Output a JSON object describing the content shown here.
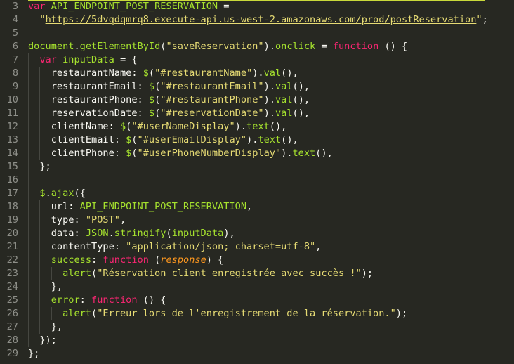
{
  "editor": {
    "lines": [
      {
        "n": "3",
        "tokens": [
          [
            "kw",
            "var "
          ],
          [
            "fn",
            "API_ENDPOINT_POST_RESERVATION"
          ],
          [
            "punct",
            " ="
          ]
        ]
      },
      {
        "n": "4",
        "tokens": [
          [
            "punct",
            "  "
          ],
          [
            "str",
            "\""
          ],
          [
            "url",
            "https://5dvqdqmrq8.execute-api.us-west-2.amazonaws.com/prod/postReservation"
          ],
          [
            "str",
            "\""
          ],
          [
            "punct",
            ";"
          ]
        ]
      },
      {
        "n": "5",
        "tokens": []
      },
      {
        "n": "6",
        "tokens": [
          [
            "fn",
            "document"
          ],
          [
            "punct",
            "."
          ],
          [
            "def",
            "getElementById"
          ],
          [
            "punct",
            "("
          ],
          [
            "str",
            "\"saveReservation\""
          ],
          [
            "punct",
            ")."
          ],
          [
            "def",
            "onclick"
          ],
          [
            "punct",
            " = "
          ],
          [
            "kw",
            "function"
          ],
          [
            "punct",
            " () {"
          ]
        ]
      },
      {
        "n": "7",
        "tokens": [
          [
            "punct",
            "  "
          ],
          [
            "kw",
            "var "
          ],
          [
            "fn",
            "inputData"
          ],
          [
            "punct",
            " = {"
          ]
        ]
      },
      {
        "n": "8",
        "tokens": [
          [
            "punct",
            "    restaurantName: "
          ],
          [
            "def",
            "$"
          ],
          [
            "punct",
            "("
          ],
          [
            "str",
            "\"#restaurantName\""
          ],
          [
            "punct",
            ")."
          ],
          [
            "def",
            "val"
          ],
          [
            "punct",
            "(),"
          ]
        ]
      },
      {
        "n": "9",
        "tokens": [
          [
            "punct",
            "    restaurantEmail: "
          ],
          [
            "def",
            "$"
          ],
          [
            "punct",
            "("
          ],
          [
            "str",
            "\"#restaurantEmail\""
          ],
          [
            "punct",
            ")."
          ],
          [
            "def",
            "val"
          ],
          [
            "punct",
            "(),"
          ]
        ]
      },
      {
        "n": "10",
        "tokens": [
          [
            "punct",
            "    restaurantPhone: "
          ],
          [
            "def",
            "$"
          ],
          [
            "punct",
            "("
          ],
          [
            "str",
            "\"#restaurantPhone\""
          ],
          [
            "punct",
            ")."
          ],
          [
            "def",
            "val"
          ],
          [
            "punct",
            "(),"
          ]
        ]
      },
      {
        "n": "11",
        "tokens": [
          [
            "punct",
            "    reservationDate: "
          ],
          [
            "def",
            "$"
          ],
          [
            "punct",
            "("
          ],
          [
            "str",
            "\"#reservationDate\""
          ],
          [
            "punct",
            ")."
          ],
          [
            "def",
            "val"
          ],
          [
            "punct",
            "(),"
          ]
        ]
      },
      {
        "n": "12",
        "tokens": [
          [
            "punct",
            "    clientName: "
          ],
          [
            "def",
            "$"
          ],
          [
            "punct",
            "("
          ],
          [
            "str",
            "\"#userNameDisplay\""
          ],
          [
            "punct",
            ")."
          ],
          [
            "def",
            "text"
          ],
          [
            "punct",
            "(),"
          ]
        ]
      },
      {
        "n": "13",
        "tokens": [
          [
            "punct",
            "    clientEmail: "
          ],
          [
            "def",
            "$"
          ],
          [
            "punct",
            "("
          ],
          [
            "str",
            "\"#userEmailDisplay\""
          ],
          [
            "punct",
            ")."
          ],
          [
            "def",
            "text"
          ],
          [
            "punct",
            "(),"
          ]
        ]
      },
      {
        "n": "14",
        "tokens": [
          [
            "punct",
            "    clientPhone: "
          ],
          [
            "def",
            "$"
          ],
          [
            "punct",
            "("
          ],
          [
            "str",
            "\"#userPhoneNumberDisplay\""
          ],
          [
            "punct",
            ")."
          ],
          [
            "def",
            "text"
          ],
          [
            "punct",
            "(),"
          ]
        ]
      },
      {
        "n": "15",
        "tokens": [
          [
            "punct",
            "  };"
          ]
        ]
      },
      {
        "n": "16",
        "tokens": []
      },
      {
        "n": "17",
        "tokens": [
          [
            "punct",
            "  "
          ],
          [
            "def",
            "$"
          ],
          [
            "punct",
            "."
          ],
          [
            "def",
            "ajax"
          ],
          [
            "punct",
            "({"
          ]
        ]
      },
      {
        "n": "18",
        "tokens": [
          [
            "punct",
            "    url: "
          ],
          [
            "fn",
            "API_ENDPOINT_POST_RESERVATION"
          ],
          [
            "punct",
            ","
          ]
        ]
      },
      {
        "n": "19",
        "tokens": [
          [
            "punct",
            "    type: "
          ],
          [
            "str",
            "\"POST\""
          ],
          [
            "punct",
            ","
          ]
        ]
      },
      {
        "n": "20",
        "tokens": [
          [
            "punct",
            "    data: "
          ],
          [
            "fn",
            "JSON"
          ],
          [
            "punct",
            "."
          ],
          [
            "def",
            "stringify"
          ],
          [
            "punct",
            "("
          ],
          [
            "fn",
            "inputData"
          ],
          [
            "punct",
            "),"
          ]
        ]
      },
      {
        "n": "21",
        "tokens": [
          [
            "punct",
            "    contentType: "
          ],
          [
            "str",
            "\"application/json; charset=utf-8\""
          ],
          [
            "punct",
            ","
          ]
        ]
      },
      {
        "n": "22",
        "tokens": [
          [
            "punct",
            "    "
          ],
          [
            "def",
            "success"
          ],
          [
            "punct",
            ": "
          ],
          [
            "kw",
            "function"
          ],
          [
            "punct",
            " ("
          ],
          [
            "param",
            "response"
          ],
          [
            "punct",
            ") {"
          ]
        ]
      },
      {
        "n": "23",
        "tokens": [
          [
            "punct",
            "      "
          ],
          [
            "def",
            "alert"
          ],
          [
            "punct",
            "("
          ],
          [
            "str",
            "\"Réservation client enregistrée avec succès !\""
          ],
          [
            "punct",
            ");"
          ]
        ]
      },
      {
        "n": "24",
        "tokens": [
          [
            "punct",
            "    },"
          ]
        ]
      },
      {
        "n": "25",
        "tokens": [
          [
            "punct",
            "    "
          ],
          [
            "def",
            "error"
          ],
          [
            "punct",
            ": "
          ],
          [
            "kw",
            "function"
          ],
          [
            "punct",
            " () {"
          ]
        ]
      },
      {
        "n": "26",
        "tokens": [
          [
            "punct",
            "      "
          ],
          [
            "def",
            "alert"
          ],
          [
            "punct",
            "("
          ],
          [
            "str",
            "\"Erreur lors de l'enregistrement de la réservation.\""
          ],
          [
            "punct",
            ");"
          ]
        ]
      },
      {
        "n": "27",
        "tokens": [
          [
            "punct",
            "    },"
          ]
        ]
      },
      {
        "n": "28",
        "tokens": [
          [
            "punct",
            "  });"
          ]
        ]
      },
      {
        "n": "29",
        "tokens": [
          [
            "punct",
            "};"
          ]
        ]
      }
    ]
  }
}
